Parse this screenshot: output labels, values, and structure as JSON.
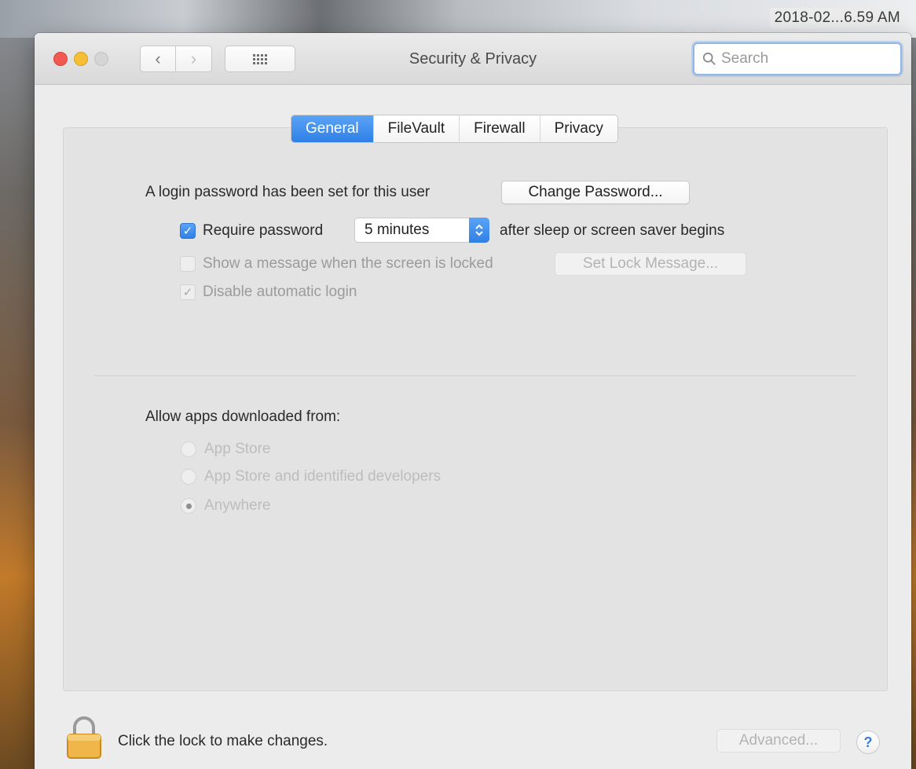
{
  "menubar": {
    "clock": "2018-02...6.59 AM"
  },
  "window": {
    "title": "Security & Privacy",
    "back_glyph": "‹",
    "forward_glyph": "›",
    "search": {
      "placeholder": "Search",
      "value": ""
    }
  },
  "tabs": [
    {
      "label": "General",
      "active": true
    },
    {
      "label": "FileVault",
      "active": false
    },
    {
      "label": "Firewall",
      "active": false
    },
    {
      "label": "Privacy",
      "active": false
    }
  ],
  "general": {
    "login_password_text": "A login password has been set for this user",
    "change_password_button": "Change Password...",
    "require_password": {
      "label": "Require password",
      "checked": true,
      "delay_selected": "5 minutes",
      "suffix": "after sleep or screen saver begins"
    },
    "show_message": {
      "label": "Show a message when the screen is locked",
      "checked": false,
      "button": "Set Lock Message..."
    },
    "disable_auto_login": {
      "label": "Disable automatic login",
      "checked": true
    },
    "allow_apps": {
      "heading": "Allow apps downloaded from:",
      "options": [
        {
          "label": "App Store",
          "selected": false
        },
        {
          "label": "App Store and identified developers",
          "selected": false
        },
        {
          "label": "Anywhere",
          "selected": true
        }
      ]
    }
  },
  "footer": {
    "lock_text": "Click the lock to make changes.",
    "advanced_button": "Advanced...",
    "help_glyph": "?"
  },
  "colors": {
    "accent": "#2f7fe6",
    "close": "#f25a51",
    "minimize": "#f6be34"
  }
}
